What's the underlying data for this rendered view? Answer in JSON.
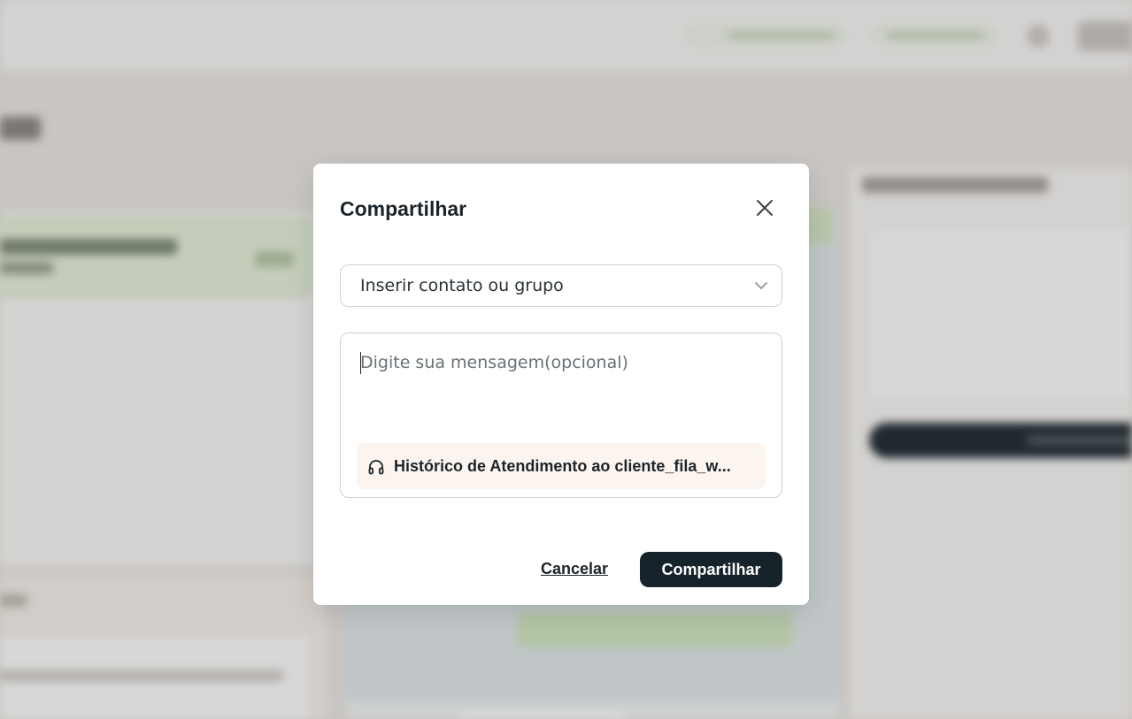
{
  "dialog": {
    "title": "Compartilhar",
    "recipient_select": {
      "value": "Inserir contato ou grupo"
    },
    "message": {
      "placeholder": "Digite sua mensagem(opcional)",
      "value": ""
    },
    "attachment": {
      "icon": "headset-icon",
      "label": "Histórico de Atendimento ao cliente_fila_w..."
    },
    "cancel_label": "Cancelar",
    "share_label": "Compartilhar"
  },
  "colors": {
    "primary_button": "#17232a",
    "attachment_bg": "#fcf5ef",
    "overlay": "rgba(40,40,40,0.17)"
  }
}
